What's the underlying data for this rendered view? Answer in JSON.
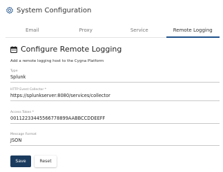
{
  "header": {
    "title": "System Configuration",
    "icon": "gear-icon",
    "accent": "#1b4f8a"
  },
  "tabs": [
    {
      "label": "Email",
      "active": false
    },
    {
      "label": "Proxy",
      "active": false
    },
    {
      "label": "Service",
      "active": false
    },
    {
      "label": "Remote Logging",
      "active": true
    }
  ],
  "section": {
    "icon": "calendar-icon",
    "title": "Configure Remote Logging",
    "description": "Add a remote logging host to the Cygna Platform"
  },
  "fields": {
    "type": {
      "label": "Type",
      "value": "Splunk"
    },
    "collector": {
      "label": "HTTP Event Collector *",
      "value": "https://splunkserver:8080/services/collector"
    },
    "token": {
      "label": "Access Token *",
      "value": "0011223344556677889​9AABBCCDDEEFF"
    },
    "format": {
      "label": "Message Format",
      "value": "JSON"
    }
  },
  "buttons": {
    "save": "Save",
    "reset": "Reset"
  },
  "colors": {
    "primary_button": "#1b3b5e"
  }
}
